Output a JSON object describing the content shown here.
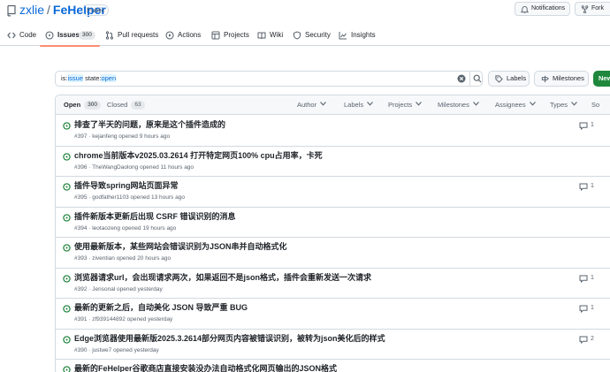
{
  "header": {
    "owner": "zxlie",
    "separator": "/",
    "repo": "FeHelper",
    "visibility": "Public",
    "notifications_label": "Notifications",
    "fork_label": "Fork"
  },
  "nav": {
    "code": "Code",
    "issues": "Issues",
    "issues_count": "300",
    "pull_requests": "Pull requests",
    "actions": "Actions",
    "projects": "Projects",
    "wiki": "Wiki",
    "security": "Security",
    "insights": "Insights"
  },
  "search": {
    "term1_key": "is:",
    "term1_value": "issue",
    "term2_key": "state:",
    "term2_value": "open"
  },
  "actions": {
    "labels": "Labels",
    "milestones": "Milestones",
    "new_issue": "New"
  },
  "list": {
    "open_label": "Open",
    "open_count": "300",
    "closed_label": "Closed",
    "closed_count": "63",
    "filters": [
      "Author",
      "Labels",
      "Projects",
      "Milestones",
      "Assignees",
      "Types",
      "So"
    ]
  },
  "issues": [
    {
      "title": "排查了半天的问题，原来是这个插件造成的",
      "meta": "#397 · kejanfeng opened 9 hours ago",
      "comments": "1"
    },
    {
      "title": "chrome当前版本v2025.03.2614 打开特定网页100% cpu占用率，卡死",
      "meta": "#396 · TheWangDaolong opened 11 hours ago",
      "comments": ""
    },
    {
      "title": "插件导致spring网站页面异常",
      "meta": "#395 · godfather1103 opened 13 hours ago",
      "comments": "1"
    },
    {
      "title": "插件新版本更新后出现 CSRF 错误识别的消息",
      "meta": "#394 · leotaozeng opened 19 hours ago",
      "comments": ""
    },
    {
      "title": "使用最新版本，某些网站会错误识别为JSON串并自动格式化",
      "meta": "#393 · ziventian opened 20 hours ago",
      "comments": ""
    },
    {
      "title": "浏览器请求url，会出现请求两次，如果返回不是json格式，插件会重新发送一次请求",
      "meta": "#392 · Jensonal opened yesterday",
      "comments": "1"
    },
    {
      "title": "最新的更新之后，自动美化 JSON 导致严重 BUG",
      "meta": "#391 · zf939144892 opened yesterday",
      "comments": "1"
    },
    {
      "title": "Edge浏览器使用最新版2025.3.2614部分网页内容被错误识别，被转为json美化后的样式",
      "meta": "#390 · justwe7 opened yesterday",
      "comments": "2"
    },
    {
      "title": "最新的FeHelper谷歌商店直接安装没办法自动格式化网页输出的JSON格式",
      "meta": "#389",
      "comments": ""
    }
  ],
  "colors": {
    "accent": "#0969da",
    "open_green": "#1a7f37",
    "new_button": "#1f883d",
    "selected_underline": "#fd8c73"
  }
}
